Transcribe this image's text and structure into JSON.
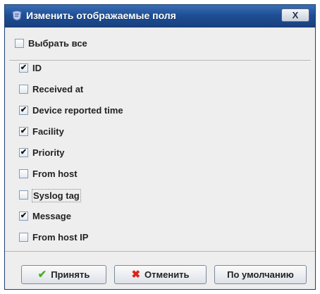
{
  "window": {
    "title": "Изменить отображаемые поля",
    "close_glyph": "X",
    "title_icon": "app-icon"
  },
  "select_all": {
    "label": "Выбрать все",
    "checked": false
  },
  "fields": [
    {
      "label": "ID",
      "checked": true
    },
    {
      "label": "Received at",
      "checked": false
    },
    {
      "label": "Device reported time",
      "checked": true
    },
    {
      "label": "Facility",
      "checked": true
    },
    {
      "label": "Priority",
      "checked": true
    },
    {
      "label": "From host",
      "checked": false
    },
    {
      "label": "Syslog tag",
      "checked": false,
      "focused": true
    },
    {
      "label": "Message",
      "checked": true
    },
    {
      "label": "From host IP",
      "checked": false
    }
  ],
  "buttons": {
    "accept": {
      "label": "Принять",
      "icon": "checkmark-icon",
      "icon_color": "#4caf2a"
    },
    "cancel": {
      "label": "Отменить",
      "icon": "cross-icon",
      "icon_color": "#d9231b"
    },
    "defaults": {
      "label": "По умолчанию"
    }
  },
  "check_glyph": "✔",
  "colors": {
    "titlebar": "#1f4f95",
    "background": "#eeeeee"
  }
}
